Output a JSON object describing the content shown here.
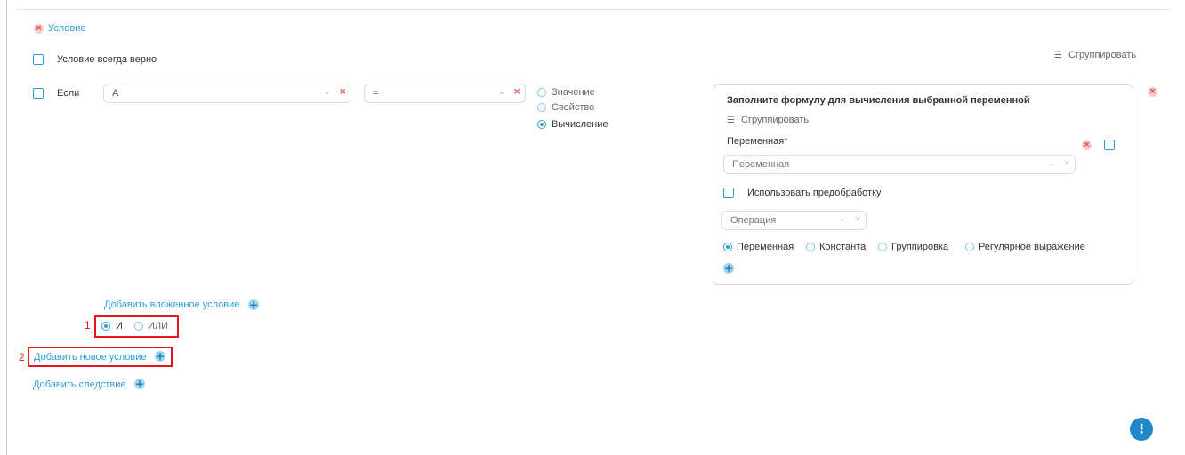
{
  "condition": {
    "remove_label": "Условие",
    "always_true_label": "Условие всегда верно",
    "group_label": "Сгруппировать"
  },
  "if_row": {
    "label": "Если",
    "left_value": "A",
    "operator_value": "=",
    "value_types": [
      {
        "label": "Значение",
        "selected": false
      },
      {
        "label": "Свойство",
        "selected": false
      },
      {
        "label": "Вычисление",
        "selected": true
      }
    ]
  },
  "formula_panel": {
    "title": "Заполните формулу для вычисления выбранной переменной",
    "group_label": "Сгруппировать",
    "variable_label": "Переменная",
    "required_mark": "*",
    "variable_placeholder": "Переменная",
    "preprocess_label": "Использовать предобработку",
    "operation_placeholder": "Операция",
    "operand_types": [
      {
        "label": "Переменная",
        "selected": true
      },
      {
        "label": "Константа",
        "selected": false
      },
      {
        "label": "Группировка",
        "selected": false
      },
      {
        "label": "Регулярное выражение",
        "selected": false
      }
    ]
  },
  "nested": {
    "add_nested_label": "Добавить вложенное условие",
    "logic_options": [
      {
        "label": "И",
        "selected": true
      },
      {
        "label": "ИЛИ",
        "selected": false
      }
    ]
  },
  "actions": {
    "add_condition_label": "Добавить новое условие",
    "add_consequence_label": "Добавить следствие"
  },
  "annotations": {
    "marker_1": "1",
    "marker_2": "2",
    "highlight_color": "#e8141d"
  },
  "colors": {
    "accent": "#2a9dd8",
    "danger": "#e23b3b",
    "fab": "#1e88c8"
  }
}
